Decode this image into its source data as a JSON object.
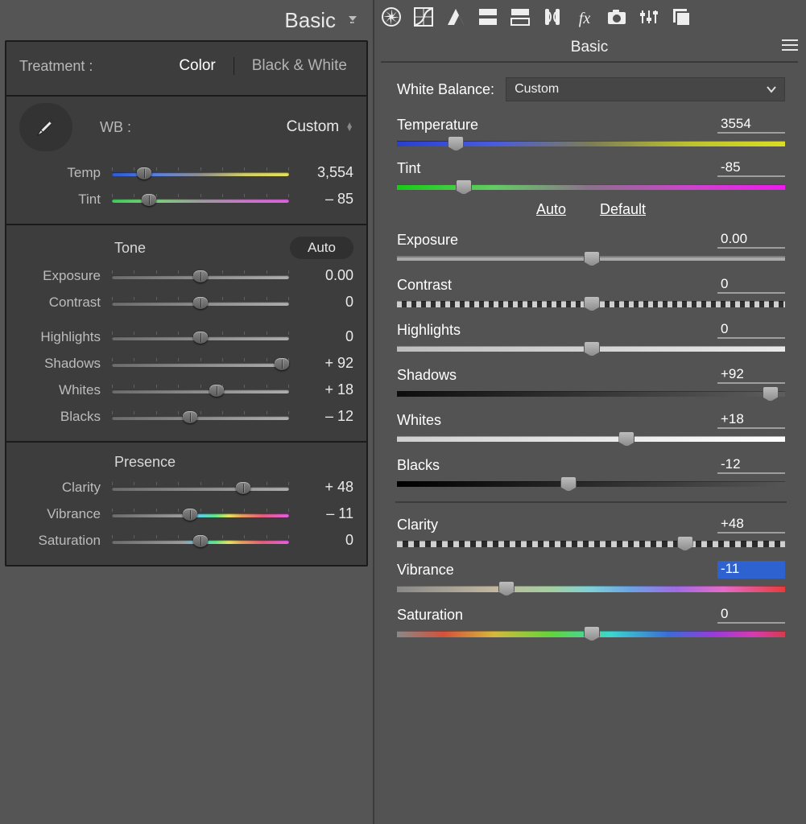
{
  "lr": {
    "title": "Basic",
    "treatment_label": "Treatment :",
    "treatment_color": "Color",
    "treatment_bw": "Black & White",
    "wb_label": "WB :",
    "wb_value": "Custom",
    "temp_label": "Temp",
    "temp_value": "3,554",
    "temp_pct": 18,
    "tint_label": "Tint",
    "tint_value": "– 85",
    "tint_pct": 21,
    "tone_label": "Tone",
    "auto_label": "Auto",
    "exposure_label": "Exposure",
    "exposure_value": "0.00",
    "exposure_pct": 50,
    "contrast_label": "Contrast",
    "contrast_value": "0",
    "contrast_pct": 50,
    "highlights_label": "Highlights",
    "highlights_value": "0",
    "highlights_pct": 50,
    "shadows_label": "Shadows",
    "shadows_value": "+ 92",
    "shadows_pct": 96,
    "whites_label": "Whites",
    "whites_value": "+ 18",
    "whites_pct": 59,
    "blacks_label": "Blacks",
    "blacks_value": "– 12",
    "blacks_pct": 44,
    "presence_label": "Presence",
    "clarity_label": "Clarity",
    "clarity_value": "+ 48",
    "clarity_pct": 74,
    "vibrance_label": "Vibrance",
    "vibrance_value": "– 11",
    "vibrance_pct": 44,
    "saturation_label": "Saturation",
    "saturation_value": "0",
    "saturation_pct": 50
  },
  "acr": {
    "title": "Basic",
    "wb_label": "White Balance:",
    "wb_value": "Custom",
    "temp_label": "Temperature",
    "temp_value": "3554",
    "temp_pct": 15,
    "tint_label": "Tint",
    "tint_value": "-85",
    "tint_pct": 17,
    "auto_label": "Auto",
    "default_label": "Default",
    "exposure_label": "Exposure",
    "exposure_value": "0.00",
    "exposure_pct": 50,
    "contrast_label": "Contrast",
    "contrast_value": "0",
    "contrast_pct": 50,
    "highlights_label": "Highlights",
    "highlights_value": "0",
    "highlights_pct": 50,
    "shadows_label": "Shadows",
    "shadows_value": "+92",
    "shadows_pct": 96,
    "whites_label": "Whites",
    "whites_value": "+18",
    "whites_pct": 59,
    "blacks_label": "Blacks",
    "blacks_value": "-12",
    "blacks_pct": 44,
    "clarity_label": "Clarity",
    "clarity_value": "+48",
    "clarity_pct": 74,
    "vibrance_label": "Vibrance",
    "vibrance_value": "-11",
    "vibrance_pct": 28,
    "saturation_label": "Saturation",
    "saturation_value": "0",
    "saturation_pct": 50
  }
}
